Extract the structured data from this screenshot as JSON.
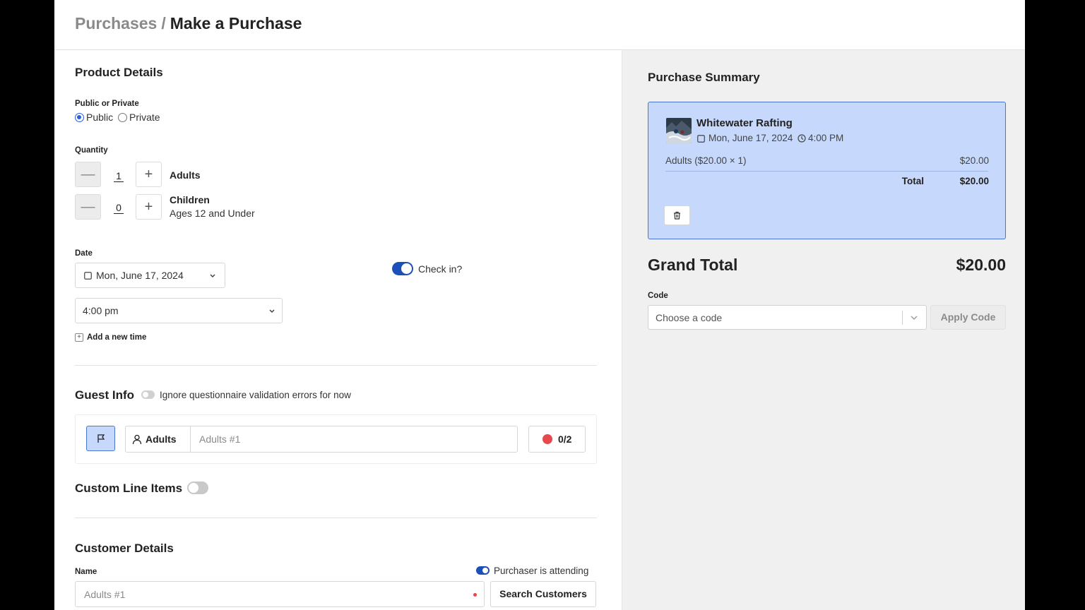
{
  "breadcrumb": {
    "parent": "Purchases",
    "separator": "/",
    "current": "Make a Purchase"
  },
  "product_details": {
    "title": "Product Details",
    "visibility": {
      "label": "Public or Private",
      "options": [
        "Public",
        "Private"
      ],
      "selected": "Public"
    },
    "quantity": {
      "label": "Quantity",
      "rows": [
        {
          "value": "1",
          "name": "Adults",
          "note": ""
        },
        {
          "value": "0",
          "name": "Children",
          "note": "Ages 12 and Under"
        }
      ]
    },
    "date": {
      "label": "Date",
      "value": "Mon, June 17, 2024"
    },
    "time": {
      "value": "4:00 pm"
    },
    "add_time_label": "Add a new time",
    "check_in": {
      "label": "Check in?",
      "on": true
    }
  },
  "guest_info": {
    "title": "Guest Info",
    "ignore_toggle_label": "Ignore questionnaire validation errors for now",
    "ignore_on": false,
    "group_label": "Adults",
    "guest_placeholder": "Adults #1",
    "count": "0/2"
  },
  "custom_line_items": {
    "title": "Custom Line Items",
    "on": false
  },
  "customer_details": {
    "title": "Customer Details",
    "name_label": "Name",
    "name_placeholder": "Adults #1",
    "attending_label": "Purchaser is attending",
    "attending_on": true,
    "search_button": "Search Customers"
  },
  "summary": {
    "title": "Purchase Summary",
    "item": {
      "name": "Whitewater Rafting",
      "date": "Mon, June 17, 2024",
      "time": "4:00 PM",
      "line_label": "Adults ($20.00 × 1)",
      "line_amount": "$20.00",
      "total_label": "Total",
      "total_amount": "$20.00"
    },
    "grand_total_label": "Grand Total",
    "grand_total_amount": "$20.00",
    "code": {
      "label": "Code",
      "placeholder": "Choose a code",
      "apply_label": "Apply Code"
    }
  },
  "colors": {
    "accent": "#1d4fb8",
    "card_bg": "#c6d8fb",
    "card_border": "#4a76d3",
    "error": "#e5484d"
  }
}
